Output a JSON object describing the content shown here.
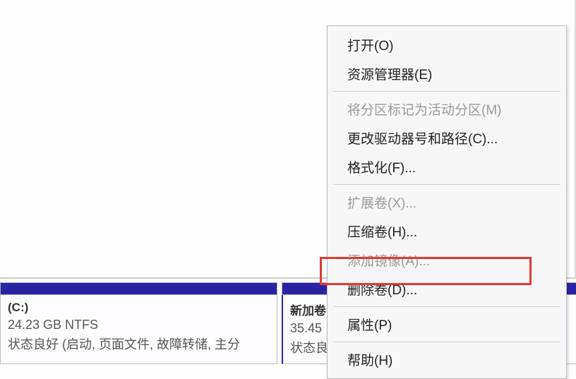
{
  "partitions": {
    "c": {
      "label": "(C:)",
      "size": "24.23 GB NTFS",
      "status": "状态良好 (启动, 页面文件, 故障转储, 主分"
    },
    "d": {
      "label": "新加卷",
      "size": "35.45",
      "status": "状态良好 (主分区)"
    }
  },
  "menu": {
    "open": "打开(O)",
    "explorer": "资源管理器(E)",
    "markActive": "将分区标记为活动分区(M)",
    "changeDrive": "更改驱动器号和路径(C)...",
    "format": "格式化(F)...",
    "extend": "扩展卷(X)...",
    "shrink": "压缩卷(H)...",
    "mirror": "添加镜像(A)...",
    "delete": "删除卷(D)...",
    "properties": "属性(P)",
    "help": "帮助(H)"
  }
}
